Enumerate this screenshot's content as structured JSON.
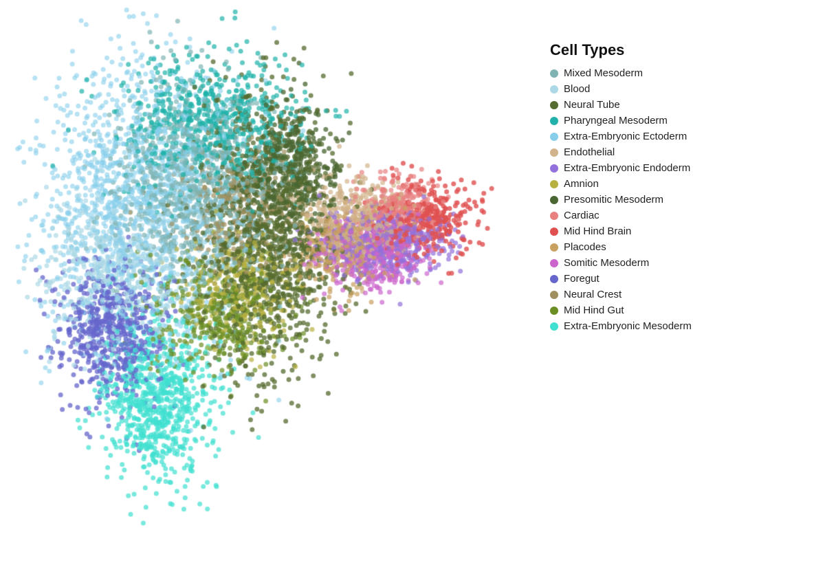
{
  "legend": {
    "title": "Cell Types",
    "items": [
      {
        "label": "Mixed Mesoderm",
        "color": "#7fb3b3"
      },
      {
        "label": "Blood",
        "color": "#add8e6"
      },
      {
        "label": "Neural Tube",
        "color": "#556b2f"
      },
      {
        "label": "Pharyngeal Mesoderm",
        "color": "#20b2aa"
      },
      {
        "label": "Extra-Embryonic Ectoderm",
        "color": "#87ceeb"
      },
      {
        "label": "Endothelial",
        "color": "#d2b48c"
      },
      {
        "label": "Extra-Embryonic Endoderm",
        "color": "#9370db"
      },
      {
        "label": "Amnion",
        "color": "#b8b040"
      },
      {
        "label": "Presomitic Mesoderm",
        "color": "#4a6630"
      },
      {
        "label": "Cardiac",
        "color": "#e88080"
      },
      {
        "label": "Mid Hind Brain",
        "color": "#e05050"
      },
      {
        "label": "Placodes",
        "color": "#c8a060"
      },
      {
        "label": "Somitic Mesoderm",
        "color": "#cc66cc"
      },
      {
        "label": "Foregut",
        "color": "#6666cc"
      },
      {
        "label": "Neural Crest",
        "color": "#a09060"
      },
      {
        "label": "Mid Hind Gut",
        "color": "#6b8e23"
      },
      {
        "label": "Extra-Embryonic Mesoderm",
        "color": "#40e0d0"
      }
    ]
  }
}
